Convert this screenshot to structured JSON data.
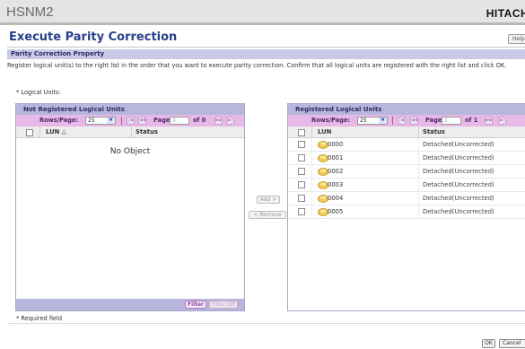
{
  "app": {
    "name": "HSNM2",
    "brand": "HITACHI"
  },
  "header": {
    "title": "Execute Parity Correction",
    "help_label": "Help"
  },
  "section": {
    "title": "Parity Correction Property",
    "instructions": "Register logical unit(s) to the right list in the order that you want to execute parity correction. Confirm that all logical units are registered with the right list and click OK.",
    "logical_units_label": "* Logical Units:"
  },
  "left_panel": {
    "title": "Not Registered Logical Units",
    "rows_per_page_label": "Rows/Page:",
    "rows_per_page_value": "25",
    "page_label": "Page",
    "page_value": "0",
    "of_label": "of 0",
    "columns": {
      "lun": "LUN △",
      "status": "Status"
    },
    "empty_message": "No Object",
    "filter_label": "Filter",
    "filter_off_label": "Filter Off"
  },
  "actions": {
    "add_label": "Add >",
    "remove_label": "< Remove"
  },
  "right_panel": {
    "title": "Registered Logical Units",
    "rows_per_page_label": "Rows/Page:",
    "rows_per_page_value": "25",
    "page_label": "Page",
    "page_value": "1",
    "of_label": "of 1",
    "columns": {
      "lun": "LUN",
      "status": "Status"
    },
    "rows": [
      {
        "lun": "0000",
        "status": "Detached(Uncorrected)"
      },
      {
        "lun": "0001",
        "status": "Detached(Uncorrected)"
      },
      {
        "lun": "0002",
        "status": "Detached(Uncorrected)"
      },
      {
        "lun": "0003",
        "status": "Detached(Uncorrected)"
      },
      {
        "lun": "0004",
        "status": "Detached(Uncorrected)"
      },
      {
        "lun": "0005",
        "status": "Detached(Uncorrected)"
      }
    ]
  },
  "footer": {
    "required_note": "* Required field",
    "ok_label": "OK",
    "cancel_label": "Cancel"
  },
  "icons": {
    "pager_first": "first-page-icon",
    "pager_prev": "prev-page-icon",
    "pager_next": "next-page-icon",
    "pager_last": "last-page-icon",
    "lun": "logical-unit-disk-icon"
  },
  "colors": {
    "title": "#27408b",
    "panel_header": "#b7b7dd",
    "pager_bg": "#e8b8e8",
    "disk": "#f2c94c"
  }
}
